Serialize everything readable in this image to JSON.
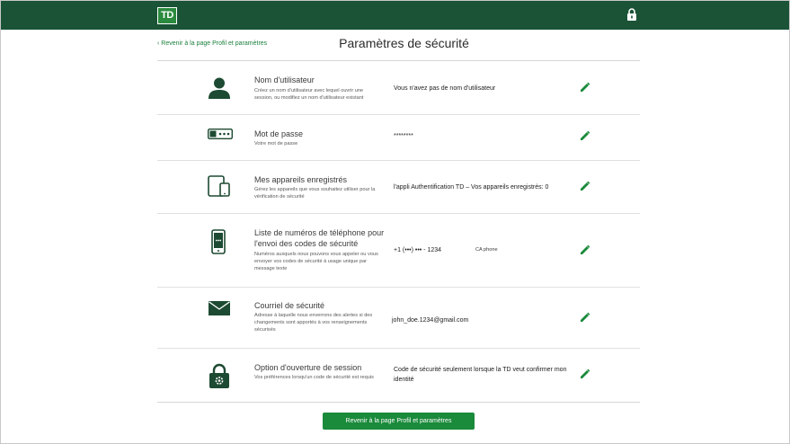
{
  "header": {
    "logo_text": "TD",
    "lock_icon": "lock-icon",
    "brand_color": "#1a5336"
  },
  "nav": {
    "back_link": "‹ Revenir à la page Profil et paramètres"
  },
  "page": {
    "title": "Paramètres de sécurité"
  },
  "rows": [
    {
      "icon": "user-icon",
      "title": "Nom d'utilisateur",
      "desc": "Créez un nom d'utilisateur avec lequel ouvrir une session, ou modifiez un nom d'utilisateur existant",
      "value": "Vous n'avez pas de nom d'utilisateur",
      "extra": ""
    },
    {
      "icon": "password-icon",
      "title": "Mot de passe",
      "desc": "Votre mot de passe",
      "value": "********",
      "extra": ""
    },
    {
      "icon": "devices-icon",
      "title": "Mes appareils enregistrés",
      "desc": "Gérez les appareils que vous souhaitez utiliser pour la vérification de sécurité",
      "value": "l'appli Authentification TD – Vos appareils enregistrés: 0",
      "extra": ""
    },
    {
      "icon": "phone-icon",
      "title": "Liste de numéros de téléphone pour l'envoi des codes de sécurité",
      "desc": "Numéros auxquels nous pouvons vous appeler ou vous envoyer vos codes de sécurité à usage unique par message texte",
      "value": "+1 (•••) ••• - 1234",
      "extra": "CA phone"
    },
    {
      "icon": "mail-icon",
      "title": "Courriel de sécurité",
      "desc": "Adresse à laquelle nous enverrons des alertes si des changements sont apportés à vos renseignements sécurisés",
      "value": "john_doe.1234@gmail.com",
      "extra": ""
    },
    {
      "icon": "lock-gear-icon",
      "title": "Option d'ouverture de session",
      "desc": "Vos préférences lorsqu'un code de sécurité est requis",
      "value": "Code de sécurité seulement lorsque la TD veut confirmer mon identité",
      "extra": ""
    }
  ],
  "edit_icon": "pencil-icon",
  "footer": {
    "button_label": "Revenir à la page Profil et paramètres"
  }
}
